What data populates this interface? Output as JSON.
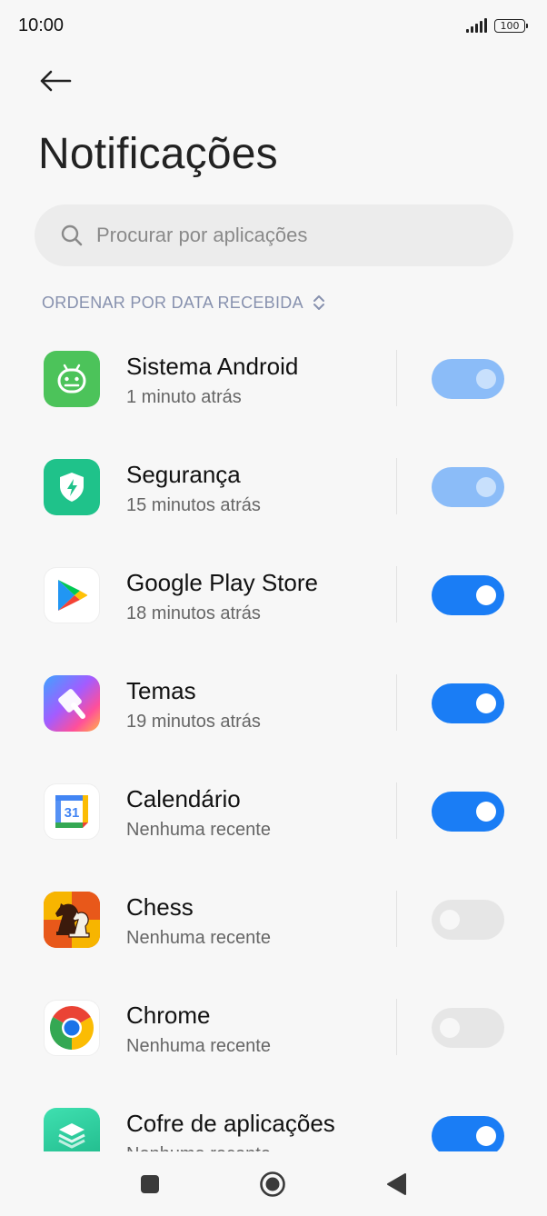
{
  "status_bar": {
    "time": "10:00",
    "battery": "100"
  },
  "header": {
    "title": "Notificações"
  },
  "search": {
    "placeholder": "Procurar por aplicações"
  },
  "sort": {
    "label": "ORDENAR POR DATA RECEBIDA"
  },
  "apps": [
    {
      "name": "Sistema Android",
      "subtitle": "1 minuto atrás",
      "toggle": "on-disabled"
    },
    {
      "name": "Segurança",
      "subtitle": "15 minutos atrás",
      "toggle": "on-disabled"
    },
    {
      "name": "Google Play Store",
      "subtitle": "18 minutos atrás",
      "toggle": "on"
    },
    {
      "name": "Temas",
      "subtitle": "19 minutos atrás",
      "toggle": "on"
    },
    {
      "name": "Calendário",
      "subtitle": "Nenhuma recente",
      "toggle": "on",
      "icon_text": "31"
    },
    {
      "name": "Chess",
      "subtitle": "Nenhuma recente",
      "toggle": "off"
    },
    {
      "name": "Chrome",
      "subtitle": "Nenhuma recente",
      "toggle": "off"
    },
    {
      "name": "Cofre de aplicações",
      "subtitle": "Nenhuma recente",
      "toggle": "on"
    }
  ],
  "colors": {
    "accent": "#1a7df5",
    "accent_disabled": "#8bbcf8",
    "off": "#e6e6e6"
  }
}
